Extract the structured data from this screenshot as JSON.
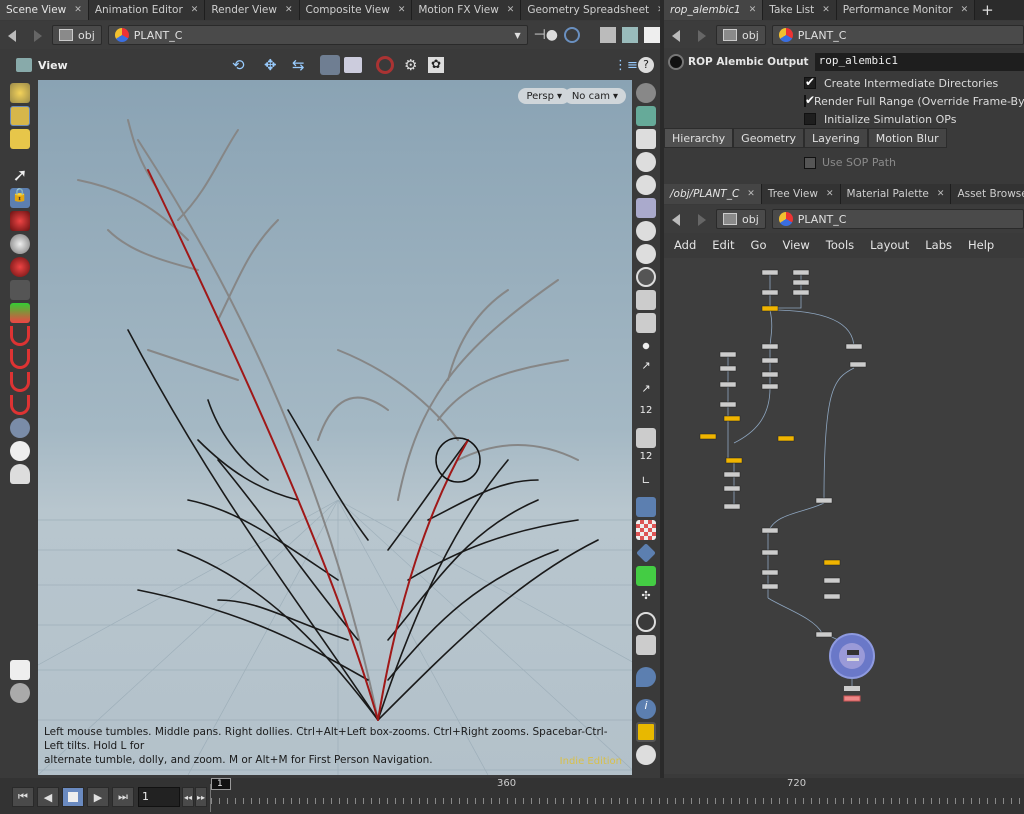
{
  "left_tabs": [
    {
      "label": "Scene View",
      "active": true
    },
    {
      "label": "Animation Editor"
    },
    {
      "label": "Render View"
    },
    {
      "label": "Composite View"
    },
    {
      "label": "Motion FX View"
    },
    {
      "label": "Geometry Spreadsheet"
    }
  ],
  "right_top_tabs": [
    {
      "label": "rop_alembic1",
      "active": true
    },
    {
      "label": "Take List"
    },
    {
      "label": "Performance Monitor"
    }
  ],
  "right_mid_tabs": [
    {
      "label": "/obj/PLANT_C",
      "active": true
    },
    {
      "label": "Tree View"
    },
    {
      "label": "Material Palette"
    },
    {
      "label": "Asset Browser"
    }
  ],
  "path": {
    "context": "obj",
    "node": "PLANT_C"
  },
  "viewport": {
    "title": "View",
    "persp": "Persp",
    "cam": "No cam",
    "help_line1": "Left mouse tumbles. Middle pans. Right dollies. Ctrl+Alt+Left box-zooms. Ctrl+Right zooms. Spacebar-Ctrl-Left tilts. Hold L for",
    "help_line2": "alternate tumble, dolly, and zoom.     M or Alt+M for First Person Navigation.",
    "edition": "Indie Edition"
  },
  "rop": {
    "type_label": "ROP Alembic Output",
    "name": "rop_alembic1",
    "checkboxes": [
      {
        "label": "Create Intermediate Directories",
        "checked": true
      },
      {
        "label": "Render Full Range (Override Frame-By-Frame)",
        "checked": true
      },
      {
        "label": "Initialize Simulation OPs",
        "checked": false
      }
    ],
    "tabs": [
      "Hierarchy",
      "Geometry",
      "Layering",
      "Motion Blur"
    ],
    "use_sop_path": "Use SOP Path"
  },
  "network_menu": [
    "Add",
    "Edit",
    "Go",
    "View",
    "Tools",
    "Layout",
    "Labs",
    "Help"
  ],
  "side_numbers": [
    "12",
    "12"
  ],
  "timeline": {
    "current_frame": "1",
    "marker": "1",
    "ticks": [
      "360",
      "720"
    ]
  },
  "colors": {
    "accent_yellow": "#f0b400",
    "stem_red": "#a01818",
    "select_blue": "#6a78c8",
    "sky_top": "#8aa3b4"
  }
}
